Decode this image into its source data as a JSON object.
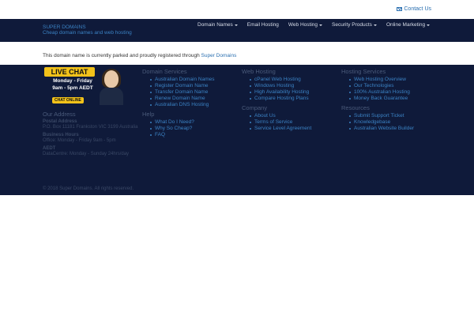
{
  "topbar": {
    "contact_label": "Contact Us"
  },
  "brand": {
    "name": "SUPER DOMAINS",
    "tagline": "Cheap domain names and web hosting"
  },
  "nav": {
    "items": [
      {
        "label": "Domain Names",
        "dropdown": true
      },
      {
        "label": "Email Hosting",
        "dropdown": false
      },
      {
        "label": "Web Hosting",
        "dropdown": true
      },
      {
        "label": "Security Products",
        "dropdown": true
      },
      {
        "label": "Online Marketing",
        "dropdown": true
      }
    ]
  },
  "notice": {
    "text": "This domain name is currently parked and proudly registered through",
    "link": "Super Domains"
  },
  "livechat": {
    "badge": "LIVE CHAT",
    "days": "Monday - Friday",
    "hours": "9am - 5pm AEDT",
    "button": "CHAT ONLINE"
  },
  "footer": {
    "our_address": {
      "heading": "Our Address",
      "postal_label": "Postal Address",
      "postal_value": "P.O. Box 11181 Frankston VIC 3199 Australia",
      "hours_label": "Business Hours",
      "hours_value": "Office: Monday - Friday 9am - 5pm",
      "aedt_label": "AEDT",
      "aedt_value": "DataCentre: Monday - Sunday 24hrs/day"
    },
    "copyright": "© 2018 Super Domains. All rights reserved.",
    "domain_services": {
      "heading": "Domain Services",
      "items": [
        "Australian Domain Names",
        "Register Domain Name",
        "Transfer Domain Name",
        "Renew Domain Name",
        "Australian DNS Hosting"
      ]
    },
    "help": {
      "heading": "Help",
      "items": [
        "What Do I Need?",
        "Why So Cheap?",
        "FAQ"
      ]
    },
    "web_hosting": {
      "heading": "Web Hosting",
      "items": [
        "cPanel Web Hosting",
        "Windows Hosting",
        "High Availability Hosting",
        "Compare Hosting Plans"
      ]
    },
    "company": {
      "heading": "Company",
      "items": [
        "About Us",
        "Terms of Service",
        "Service Level Agreement"
      ]
    },
    "hosting_services": {
      "heading": "Hosting Services",
      "items": [
        "Web Hosting Overview",
        "Our Technologies",
        "100% Australian Hosting",
        "Money Back Guarantee"
      ]
    },
    "resources": {
      "heading": "Resources",
      "items": [
        "Submit Support Ticket",
        "Knowledgebase",
        "Australian Website Builder"
      ]
    }
  }
}
